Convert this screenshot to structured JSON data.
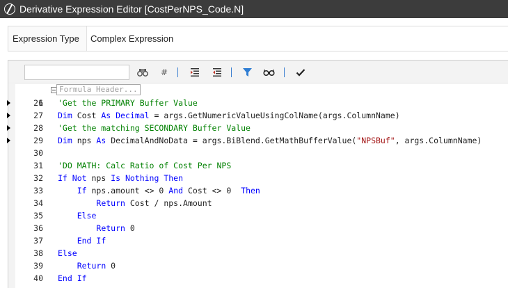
{
  "window": {
    "title": "Derivative Expression Editor  [CostPerNPS_Code.N]"
  },
  "expression_type": {
    "label": "Expression Type",
    "value": "Complex Expression"
  },
  "toolbar": {
    "search_value": "",
    "buttons": [
      "binoculars-search-icon",
      "hash-icon",
      "indent-icon",
      "outdent-icon",
      "filter-icon",
      "glasses-icon",
      "checkmark-icon"
    ],
    "hash_label": "#"
  },
  "editor": {
    "fold_line_number": "1",
    "fold_header": "Formula Header...",
    "breakpoint_lines": [
      26,
      27,
      28,
      29
    ],
    "lines": [
      {
        "n": "26",
        "indent": "",
        "segs": [
          {
            "t": "'Get the PRIMARY Buffer Value",
            "c": "cm"
          }
        ]
      },
      {
        "n": "27",
        "indent": "",
        "segs": [
          {
            "t": "Dim",
            "c": "kw"
          },
          {
            "t": " Cost ",
            "c": "pl"
          },
          {
            "t": "As",
            "c": "kw"
          },
          {
            "t": " ",
            "c": "pl"
          },
          {
            "t": "Decimal",
            "c": "kw"
          },
          {
            "t": " = args.GetNumericValueUsingColName(args.ColumnName)",
            "c": "pl"
          }
        ]
      },
      {
        "n": "28",
        "indent": "",
        "segs": [
          {
            "t": "'Get the matching SECONDARY Buffer Value",
            "c": "cm"
          }
        ]
      },
      {
        "n": "29",
        "indent": "",
        "segs": [
          {
            "t": "Dim",
            "c": "kw"
          },
          {
            "t": " nps ",
            "c": "pl"
          },
          {
            "t": "As",
            "c": "kw"
          },
          {
            "t": " DecimalAndNoData = args.BiBlend.GetMathBufferValue(",
            "c": "pl"
          },
          {
            "t": "\"NPSBuf\"",
            "c": "st"
          },
          {
            "t": ", args.ColumnName)",
            "c": "pl"
          }
        ]
      },
      {
        "n": "30",
        "indent": "",
        "segs": []
      },
      {
        "n": "31",
        "indent": "",
        "segs": [
          {
            "t": "'DO MATH: Calc Ratio of Cost Per NPS",
            "c": "cm"
          }
        ]
      },
      {
        "n": "32",
        "indent": "",
        "segs": [
          {
            "t": "If Not",
            "c": "kw"
          },
          {
            "t": " nps ",
            "c": "pl"
          },
          {
            "t": "Is Nothing Then",
            "c": "kw"
          }
        ]
      },
      {
        "n": "33",
        "indent": "    ",
        "segs": [
          {
            "t": "If",
            "c": "kw"
          },
          {
            "t": " nps.amount <> 0 ",
            "c": "pl"
          },
          {
            "t": "And",
            "c": "kw"
          },
          {
            "t": " Cost <> 0  ",
            "c": "pl"
          },
          {
            "t": "Then",
            "c": "kw"
          }
        ]
      },
      {
        "n": "34",
        "indent": "        ",
        "segs": [
          {
            "t": "Return",
            "c": "kw"
          },
          {
            "t": " Cost / nps.Amount",
            "c": "pl"
          }
        ]
      },
      {
        "n": "35",
        "indent": "    ",
        "segs": [
          {
            "t": "Else",
            "c": "kw"
          }
        ]
      },
      {
        "n": "36",
        "indent": "        ",
        "segs": [
          {
            "t": "Return",
            "c": "kw"
          },
          {
            "t": " 0",
            "c": "pl"
          }
        ]
      },
      {
        "n": "37",
        "indent": "    ",
        "segs": [
          {
            "t": "End If",
            "c": "kw"
          }
        ]
      },
      {
        "n": "38",
        "indent": "",
        "segs": [
          {
            "t": "Else",
            "c": "kw"
          }
        ]
      },
      {
        "n": "39",
        "indent": "    ",
        "segs": [
          {
            "t": "Return",
            "c": "kw"
          },
          {
            "t": " 0",
            "c": "pl"
          }
        ]
      },
      {
        "n": "40",
        "indent": "",
        "segs": [
          {
            "t": "End If",
            "c": "kw"
          }
        ]
      }
    ]
  }
}
